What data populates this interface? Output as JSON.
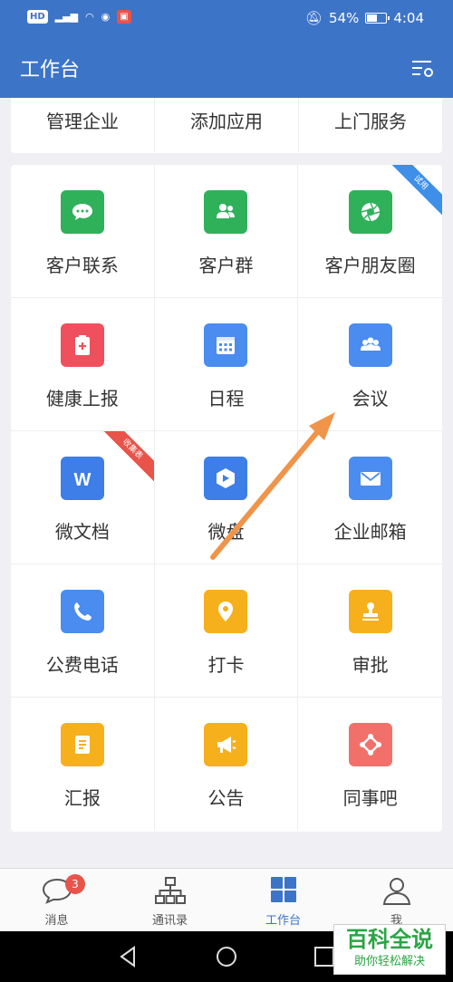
{
  "status": {
    "battery": "54%",
    "time": "4:04",
    "left_chips": [
      "HD",
      "46"
    ],
    "battery_level": 0.54
  },
  "header": {
    "title": "工作台"
  },
  "top_shortcuts": [
    {
      "label": "管理企业"
    },
    {
      "label": "添加应用"
    },
    {
      "label": "上门服务"
    }
  ],
  "apps": [
    {
      "label": "客户联系",
      "icon": "chat-bubble-icon",
      "color": "#2fb15a"
    },
    {
      "label": "客户群",
      "icon": "group-icon",
      "color": "#2fb15a"
    },
    {
      "label": "客户朋友圈",
      "icon": "aperture-icon",
      "color": "#2fb15a",
      "ribbon": "试用",
      "ribbon_color": "#3d8fe8"
    },
    {
      "label": "健康上报",
      "icon": "health-report-icon",
      "color": "#f0505d"
    },
    {
      "label": "日程",
      "icon": "calendar-icon",
      "color": "#4a8cf0"
    },
    {
      "label": "会议",
      "icon": "meeting-icon",
      "color": "#4a8cf0"
    },
    {
      "label": "微文档",
      "icon": "document-w-icon",
      "color": "#3d7ee8",
      "ribbon": "收集表",
      "ribbon_color": "#e8534a"
    },
    {
      "label": "微盘",
      "icon": "cloud-disk-icon",
      "color": "#3d7ee8"
    },
    {
      "label": "企业邮箱",
      "icon": "mail-icon",
      "color": "#4a8cf0"
    },
    {
      "label": "公费电话",
      "icon": "phone-icon",
      "color": "#4a8cf0"
    },
    {
      "label": "打卡",
      "icon": "location-pin-icon",
      "color": "#f6b01c"
    },
    {
      "label": "审批",
      "icon": "stamp-icon",
      "color": "#f6b01c"
    },
    {
      "label": "汇报",
      "icon": "report-icon",
      "color": "#f6b01c"
    },
    {
      "label": "公告",
      "icon": "megaphone-icon",
      "color": "#f6b01c"
    },
    {
      "label": "同事吧",
      "icon": "network-icon",
      "color": "#f2706a"
    }
  ],
  "tabs": [
    {
      "label": "消息",
      "icon": "message-icon",
      "badge": "3"
    },
    {
      "label": "通讯录",
      "icon": "org-chart-icon"
    },
    {
      "label": "工作台",
      "icon": "grid-icon",
      "active": true
    },
    {
      "label": "我",
      "icon": "person-icon"
    }
  ],
  "watermark": {
    "main": "百科全说",
    "sub": "助你轻松解决"
  },
  "colors": {
    "primary": "#3c74c8",
    "annotation_arrow": "#f0944a"
  }
}
